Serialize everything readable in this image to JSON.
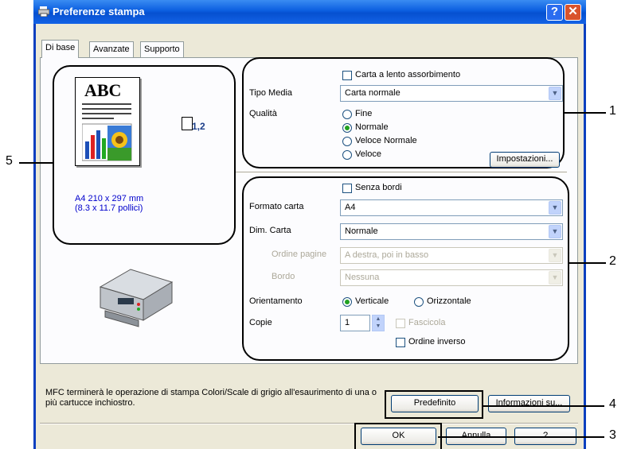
{
  "window": {
    "title": "Preferenze stampa"
  },
  "tabs": [
    "Di base",
    "Avanzate",
    "Supporto"
  ],
  "preview": {
    "abc_text": "ABC",
    "pages_label": "1,2",
    "size_line1": "A4 210 x 297 mm",
    "size_line2": "(8.3 x 11.7 pollici)"
  },
  "media": {
    "slow_dry_label": "Carta a lento assorbimento",
    "type_label": "Tipo Media",
    "type_value": "Carta normale",
    "quality_label": "Qualità",
    "quality_options": [
      "Fine",
      "Normale",
      "Veloce Normale",
      "Veloce"
    ],
    "quality_selected": "Normale",
    "settings_button": "Impostazioni..."
  },
  "paper": {
    "borderless_label": "Senza bordi",
    "size_label": "Formato carta",
    "size_value": "A4",
    "dim_label": "Dim. Carta",
    "dim_value": "Normale",
    "page_order_label": "Ordine pagine",
    "page_order_value": "A destra, poi in basso",
    "border_label": "Bordo",
    "border_value": "Nessuna",
    "orientation_label": "Orientamento",
    "portrait_label": "Verticale",
    "landscape_label": "Orizzontale",
    "orientation_selected": "Verticale",
    "copies_label": "Copie",
    "copies_value": "1",
    "collate_label": "Fascicola",
    "reverse_label": "Ordine inverso"
  },
  "footer": {
    "message": "MFC terminerà le operazione di stampa Colori/Scale di grigio all'esaurimento di una o più cartucce inchiostro.",
    "default_button": "Predefinito",
    "about_button": "Informazioni su...",
    "ok_button": "OK",
    "cancel_button": "Annulla",
    "help_button": "?"
  },
  "callouts": [
    "1",
    "2",
    "3",
    "4",
    "5"
  ],
  "colors": {
    "titlebar": "#0b5ee0",
    "window_bg": "#ece9d8",
    "radio_dot": "#21a121",
    "close_button": "#d9532c"
  }
}
